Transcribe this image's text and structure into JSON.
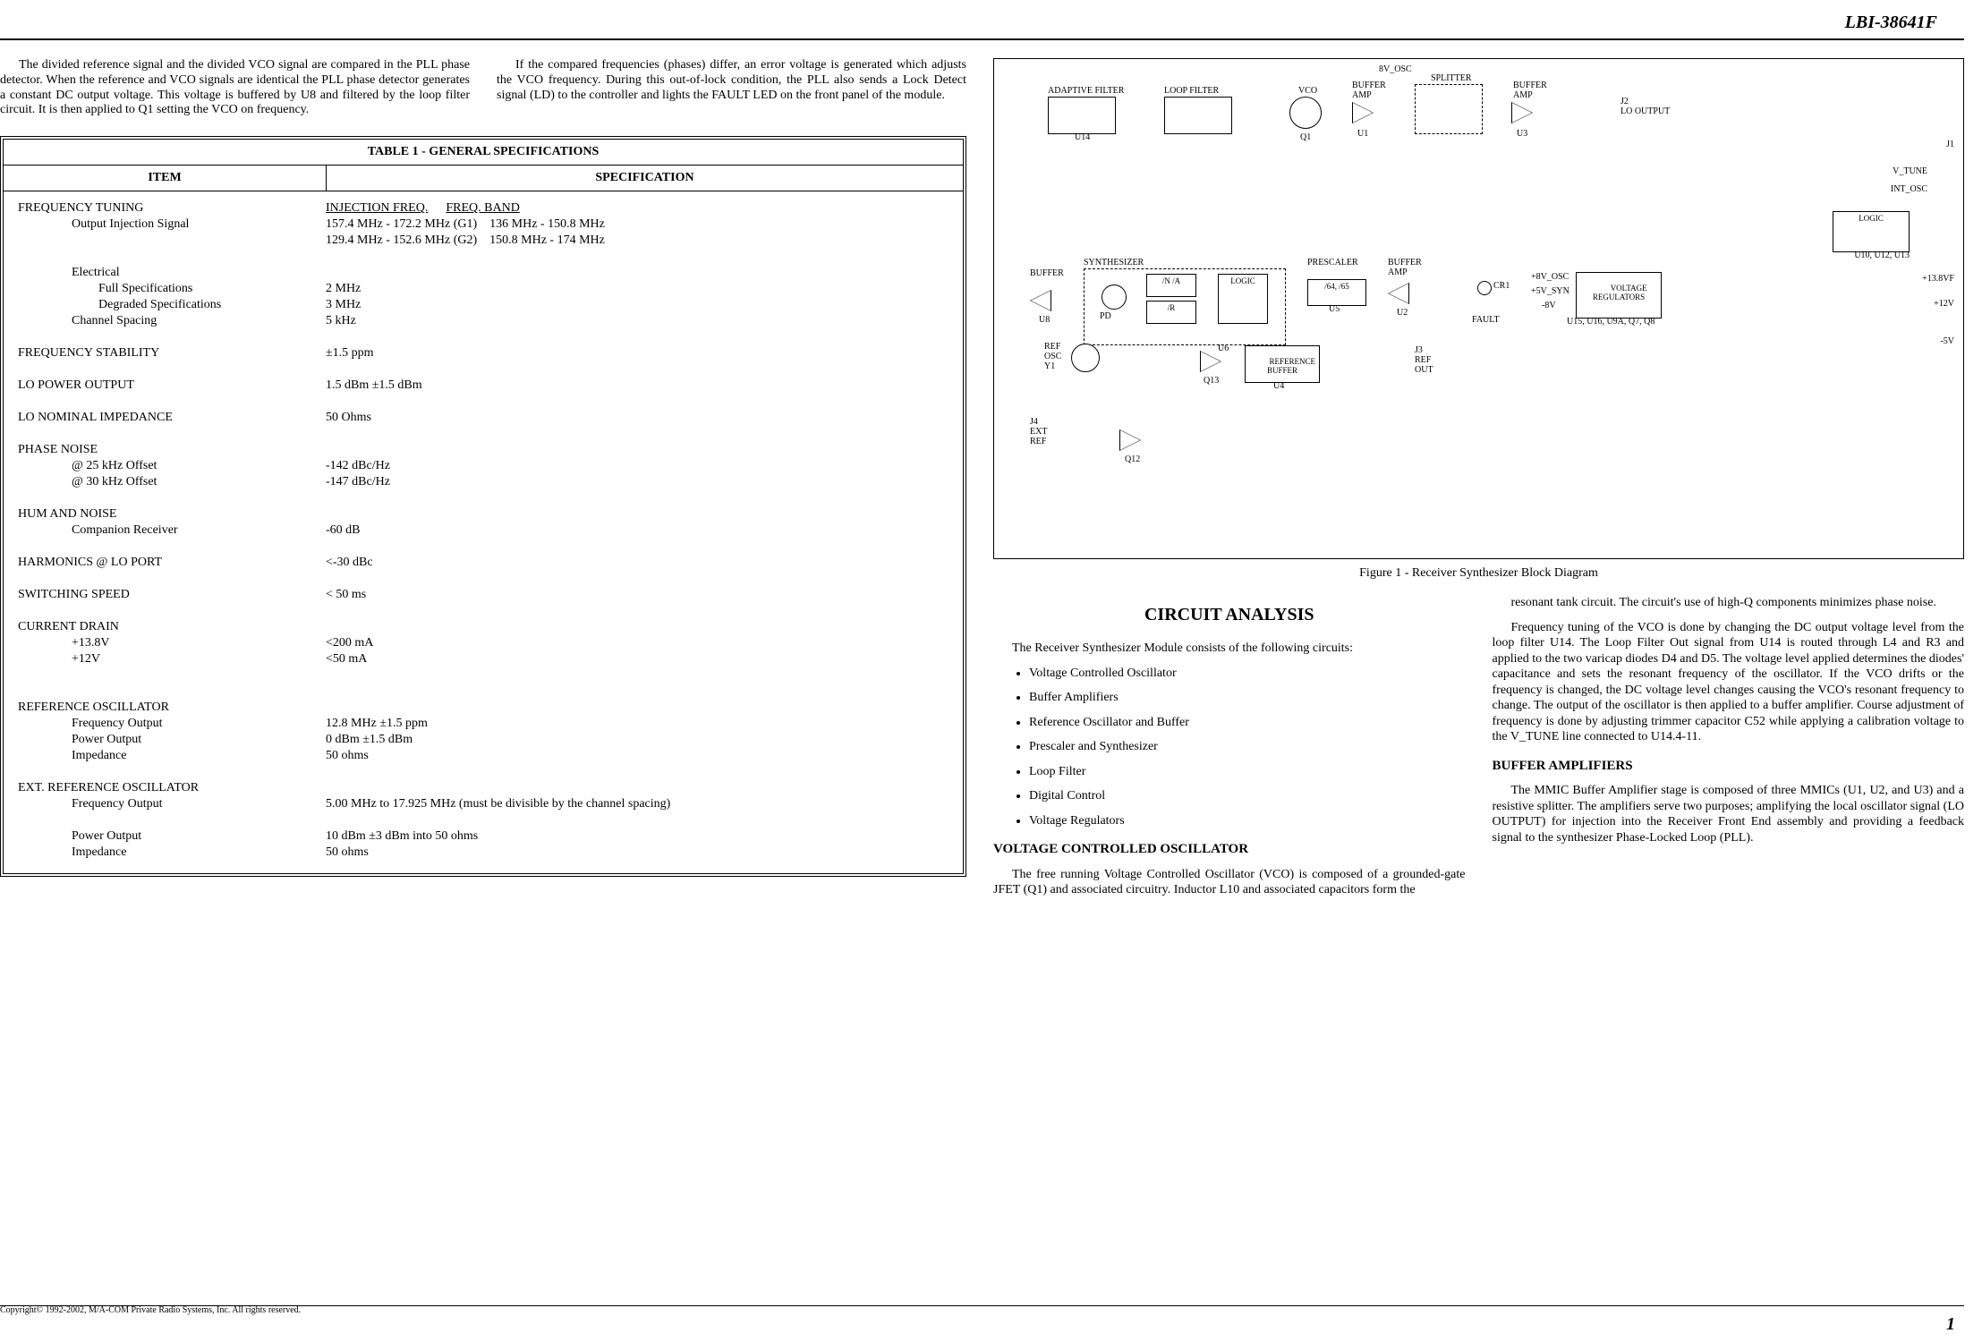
{
  "doc_id": "LBI-38641F",
  "page_number": "1",
  "copyright": "Copyright© 1992-2002, M/A-COM Private Radio Systems, Inc. All rights reserved.",
  "intro_left": "The divided reference signal and the divided VCO signal are compared in the PLL phase detector. When the reference and VCO signals are identical the PLL phase detector generates a constant DC output voltage. This voltage is buffered by U8 and filtered by the loop filter circuit. It is then applied to Q1 setting the VCO on frequency.",
  "intro_right": "If the compared frequencies (phases) differ, an error voltage is generated which adjusts the VCO frequency. During this out-of-lock condition, the PLL also sends a Lock Detect signal (LD) to the controller and lights the FAULT LED on the front panel of the module.",
  "table": {
    "title": "TABLE 1 - GENERAL SPECIFICATIONS",
    "head_item": "ITEM",
    "head_spec": "SPECIFICATION",
    "rows": [
      {
        "item": "FREQUENCY TUNING",
        "sub": [
          {
            "label": "Output Injection Signal",
            "spec_headers": [
              "INJECTION FREQ.",
              "FREQ. BAND"
            ],
            "spec_lines": [
              "157.4 MHz - 172.2 MHz (G1)    136 MHz - 150.8 MHz",
              "129.4 MHz - 152.6 MHz (G2)    150.8 MHz - 174 MHz"
            ]
          },
          {
            "label": "Electrical",
            "sub": [
              {
                "label": "Full Specifications",
                "spec": "2 MHz"
              },
              {
                "label": "Degraded Specifications",
                "spec": "3 MHz"
              }
            ]
          },
          {
            "label": "Channel Spacing",
            "spec": "5 kHz"
          }
        ]
      },
      {
        "item": "FREQUENCY STABILITY",
        "spec": "±1.5 ppm"
      },
      {
        "item": "LO POWER OUTPUT",
        "spec": "1.5 dBm ±1.5 dBm"
      },
      {
        "item": "LO NOMINAL IMPEDANCE",
        "spec": "50 Ohms"
      },
      {
        "item": "PHASE NOISE",
        "sub": [
          {
            "label": "@ 25 kHz Offset",
            "spec": "-142 dBc/Hz"
          },
          {
            "label": "@ 30 kHz Offset",
            "spec": "-147 dBc/Hz"
          }
        ]
      },
      {
        "item": "HUM AND NOISE",
        "sub": [
          {
            "label": "Companion Receiver",
            "spec": "-60 dB"
          }
        ]
      },
      {
        "item": "HARMONICS @ LO PORT",
        "spec": "<-30 dBc"
      },
      {
        "item": "SWITCHING SPEED",
        "spec": "< 50 ms"
      },
      {
        "item": "CURRENT DRAIN",
        "sub": [
          {
            "label": "+13.8V",
            "spec": "<200 mA"
          },
          {
            "label": "+12V",
            "spec": "<50 mA"
          }
        ]
      },
      {
        "item": "REFERENCE OSCILLATOR",
        "sub": [
          {
            "label": "Frequency Output",
            "spec": "12.8 MHz ±1.5 ppm"
          },
          {
            "label": "Power Output",
            "spec": "0 dBm ±1.5 dBm"
          },
          {
            "label": "Impedance",
            "spec": "50 ohms"
          }
        ]
      },
      {
        "item": "EXT. REFERENCE OSCILLATOR",
        "sub": [
          {
            "label": "Frequency Output",
            "spec": "5.00 MHz to 17.925 MHz (must be divisible by the channel spacing)"
          },
          {
            "label": "Power Output",
            "spec": "10 dBm ±3 dBm into 50 ohms"
          },
          {
            "label": "Impedance",
            "spec": "50 ohms"
          }
        ]
      }
    ]
  },
  "figure_caption": "Figure 1 - Receiver Synthesizer Block Diagram",
  "diagram_labels": {
    "adaptive_filter": "ADAPTIVE  FILTER",
    "loop_filter": "LOOP  FILTER",
    "u14": "U14",
    "vco": "VCO",
    "q1": "Q1",
    "buffer_amp": "BUFFER\nAMP",
    "u1": "U1",
    "splitter": "SPLITTER",
    "u3": "U3",
    "j2": "J2\nLO OUTPUT",
    "j1": "J1",
    "v_tune": "V_TUNE",
    "int_osc": "INT_OSC",
    "logic": "LOGIC",
    "u10_u12_u13": "U10, U12, U13",
    "synth": "SYNTHESIZER",
    "buffer": "BUFFER",
    "u8": "U8",
    "pd": "PD",
    "divN_A": "/N   /A",
    "divR": "/R",
    "logic2": "LOGIC",
    "prescaler": "PRESCALER",
    "div64_65": "/64,   /65",
    "u5": "U5",
    "u6": "U6",
    "u2": "U2",
    "reference_buffer": "REFERENCE\nBUFFER",
    "u4": "U4",
    "q13": "Q13",
    "q12": "Q12",
    "ref_osc_y1": "REF\nOSC\nY1",
    "j4_ext_ref": "J4\nEXT\nREF",
    "j3_ref_out": "J3\nREF\nOUT",
    "ref_out": "REF\nOUT",
    "cr1": "CR1",
    "fault": "FAULT",
    "plus8v_osc": "+8V_OSC",
    "plus5v_syn": "+5V_SYN",
    "minus8v": "-8V",
    "voltage_regulators": "VOLTAGE\nREGULATORS",
    "u15_etc": "U15, U16, U9A, Q7, Q8",
    "plus13_8vf": "+13.8VF",
    "plus12v": "+12V",
    "minus5v": "-5V",
    "eightv_osc_top": "8V_OSC"
  },
  "analysis": {
    "title": "CIRCUIT ANALYSIS",
    "intro": "The Receiver Synthesizer Module consists of the following circuits:",
    "circuits": [
      "Voltage Controlled Oscillator",
      "Buffer Amplifiers",
      "Reference Oscillator and Buffer",
      "Prescaler and Synthesizer",
      "Loop Filter",
      "Digital Control",
      "Voltage Regulators"
    ],
    "vco_h": "VOLTAGE CONTROLLED OSCILLATOR",
    "vco_p1": "The free running Voltage Controlled Oscillator (VCO) is composed of a grounded-gate JFET (Q1) and associated circuitry. Inductor L10 and associated capacitors form the",
    "right_p1": "resonant tank circuit. The circuit's use of high-Q components minimizes phase noise.",
    "right_p2": "Frequency tuning of the VCO is done by changing the DC output voltage level from the loop filter U14. The Loop Filter Out signal from U14 is routed through L4 and R3 and applied to the two varicap diodes D4 and D5. The voltage level applied determines the diodes' capacitance and sets the resonant frequency of the oscillator. If the VCO drifts or the frequency is changed, the DC voltage level changes causing the VCO's resonant frequency to change. The output of the oscillator is then applied to a buffer amplifier. Course adjustment of frequency is done by adjusting trimmer capacitor C52 while applying a calibration voltage to the V_TUNE line connected to U14.4-11.",
    "buf_h": "BUFFER AMPLIFIERS",
    "buf_p": "The MMIC Buffer Amplifier stage is composed of three MMICs (U1, U2, and U3) and a resistive splitter. The amplifiers serve two purposes; amplifying the local oscillator signal (LO OUTPUT) for injection into the Receiver Front End assembly and providing a feedback signal to the synthesizer Phase-Locked Loop (PLL)."
  }
}
